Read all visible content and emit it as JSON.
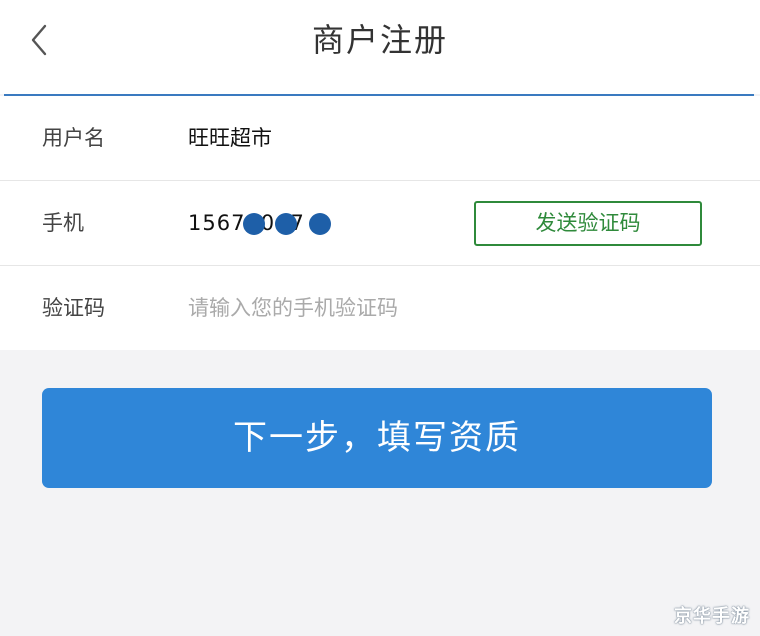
{
  "header": {
    "title": "商户注册",
    "back_icon": "chevron-left-icon"
  },
  "form": {
    "username": {
      "label": "用户名",
      "value": "旺旺超市"
    },
    "phone": {
      "label": "手机",
      "value": "1567  0  7",
      "mask_icon": "redaction-dot-icon",
      "mask_color": "#1e5fa8"
    },
    "send_code_button": {
      "label": "发送验证码",
      "color": "#2f8a3b"
    },
    "verification": {
      "label": "验证码",
      "placeholder": "请输入您的手机验证码",
      "value": ""
    }
  },
  "next_button": {
    "label": "下一步，填写资质",
    "color": "#2f86d8"
  },
  "watermark": {
    "text": "京华手游"
  },
  "colors": {
    "accent_line": "#3a7ac0",
    "background": "#f3f3f5"
  }
}
